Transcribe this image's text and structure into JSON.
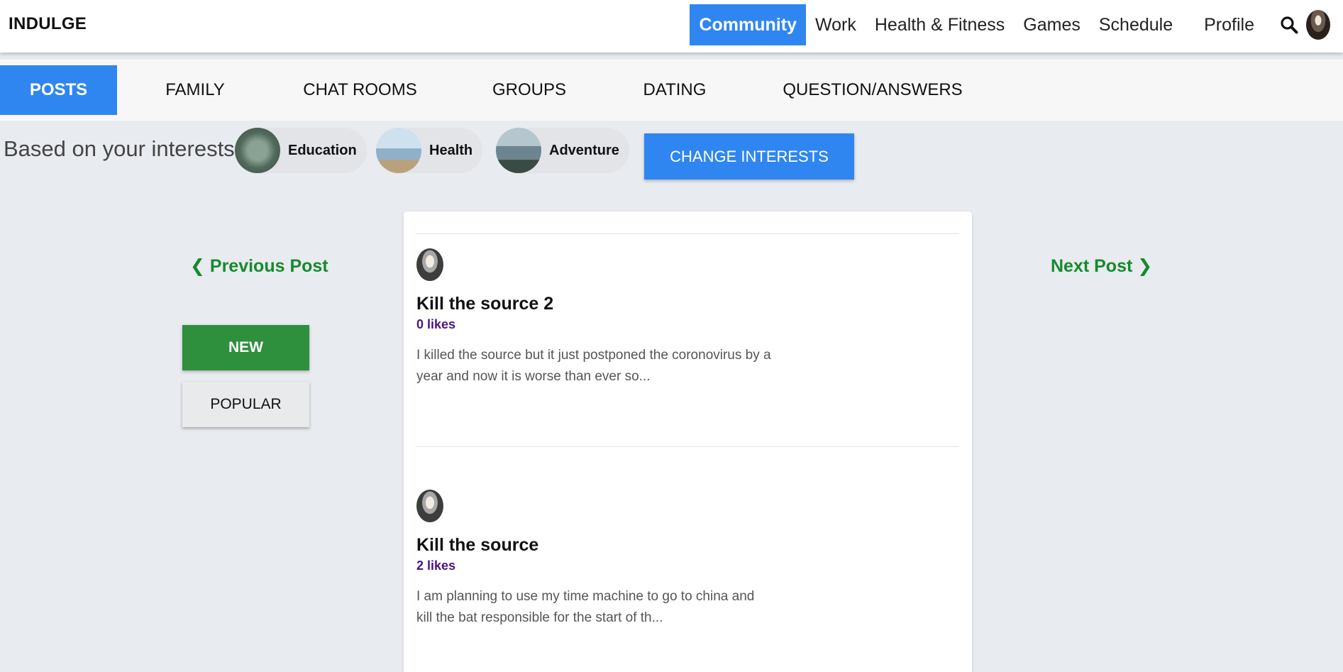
{
  "brand": "INDULGE",
  "nav": {
    "items": [
      "Community",
      "Work",
      "Health & Fitness",
      "Games",
      "Schedule",
      "Profile"
    ],
    "active": "Community"
  },
  "subtabs": [
    "POSTS",
    "FAMILY",
    "CHAT ROOMS",
    "GROUPS",
    "DATING",
    "QUESTION/ANSWERS"
  ],
  "interests": {
    "label": "Based on your interests:",
    "chips": [
      "Education",
      "Health",
      "Adventure"
    ],
    "change_button": "CHANGE INTERESTS"
  },
  "post_nav": {
    "previous": "❮ Previous Post",
    "next": "Next Post ❯"
  },
  "sort": {
    "new": "NEW",
    "popular": "POPULAR"
  },
  "posts": [
    {
      "title": "Kill the source 2",
      "likes": "0 likes",
      "body": "I killed the source but it just postponed the coronovirus by a year and now it is worse than ever so..."
    },
    {
      "title": "Kill the source",
      "likes": "2 likes",
      "body": "I am planning to use my time machine to go to china and kill the bat responsible for the start of th..."
    }
  ],
  "colors": {
    "primary": "#2f86f0",
    "success": "#2e8f3d",
    "link_green": "#178a2c",
    "likes": "#4a1486",
    "background": "#e8ebef"
  }
}
